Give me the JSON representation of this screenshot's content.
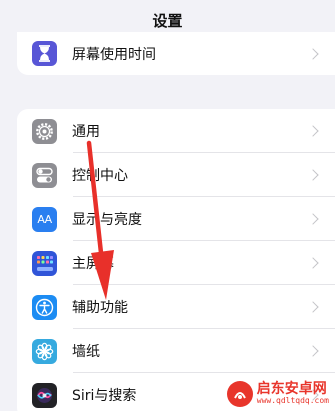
{
  "nav": {
    "title": "设置"
  },
  "groups": {
    "top": [
      {
        "label": "屏幕使用时间",
        "icon": "hourglass-icon",
        "color": "#5856d6"
      }
    ],
    "main": [
      {
        "label": "通用",
        "icon": "gear-icon",
        "color": "#8e8e93"
      },
      {
        "label": "控制中心",
        "icon": "toggles-icon",
        "color": "#8e8e93"
      },
      {
        "label": "显示与亮度",
        "icon": "text-size-icon",
        "color": "#2a7ff0"
      },
      {
        "label": "主屏幕",
        "icon": "app-grid-icon",
        "color": "#3055d8"
      },
      {
        "label": "辅助功能",
        "icon": "accessibility-icon",
        "color": "#1c8cf3"
      },
      {
        "label": "墙纸",
        "icon": "flower-icon",
        "color": "#36aadf"
      },
      {
        "label": "Siri与搜索",
        "icon": "siri-icon",
        "color": "#222226"
      }
    ]
  },
  "display_icon_text": "AA",
  "watermark": {
    "name": "启东安卓网",
    "url": "www.qdltqdq.com",
    "color": "#e8352b"
  },
  "annotation_color": "#e8302a"
}
